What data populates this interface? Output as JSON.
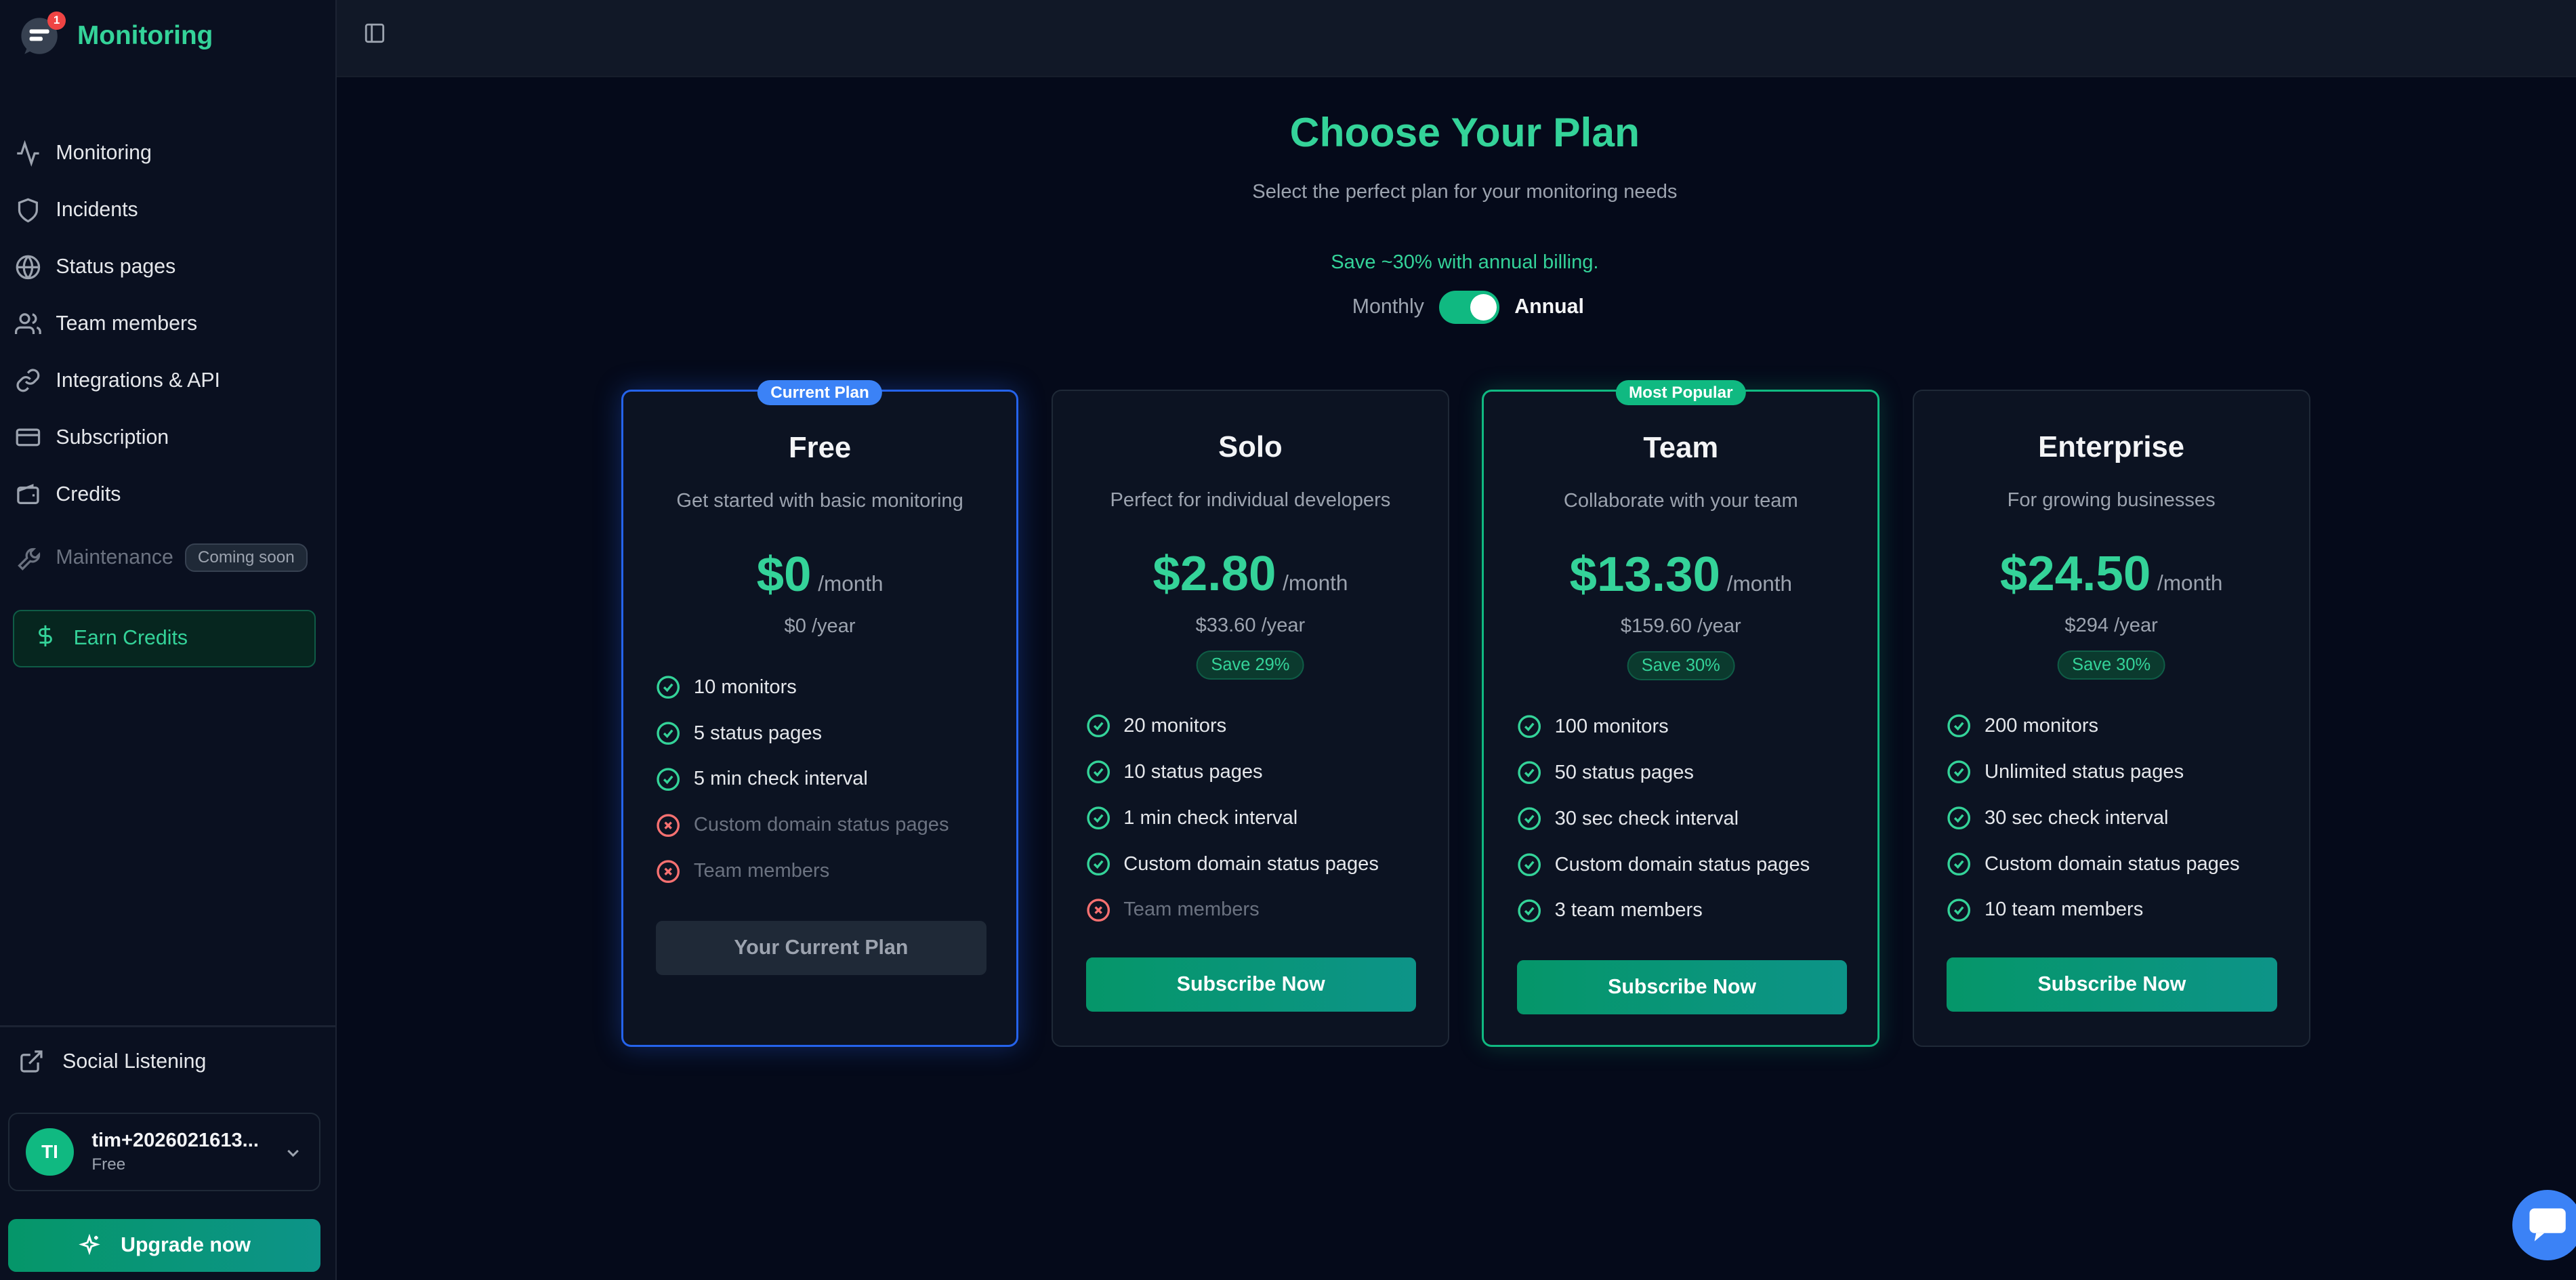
{
  "app": {
    "name": "Monitoring",
    "notification_count": "1"
  },
  "sidebar": {
    "items": [
      {
        "label": "Monitoring",
        "icon": "activity-icon"
      },
      {
        "label": "Incidents",
        "icon": "shield-icon"
      },
      {
        "label": "Status pages",
        "icon": "globe-icon"
      },
      {
        "label": "Team members",
        "icon": "users-icon"
      },
      {
        "label": "Integrations & API",
        "icon": "link-icon"
      },
      {
        "label": "Subscription",
        "icon": "credit-card-icon"
      },
      {
        "label": "Credits",
        "icon": "wallet-icon"
      }
    ],
    "maintenance": {
      "label": "Maintenance",
      "badge": "Coming soon"
    },
    "earn_credits": "Earn Credits",
    "social_listening": "Social Listening",
    "user": {
      "initials": "TI",
      "name": "tim+2026021613...",
      "plan": "Free"
    },
    "upgrade": "Upgrade now"
  },
  "page": {
    "title": "Choose Your Plan",
    "subtitle": "Select the perfect plan for your monitoring needs",
    "save_note": "Save ~30% with annual billing.",
    "billing": {
      "monthly": "Monthly",
      "annual": "Annual",
      "annual_selected": true
    }
  },
  "plans": [
    {
      "name": "Free",
      "tag": "Current Plan",
      "description": "Get started with basic monitoring",
      "price": "$0",
      "per": "/month",
      "yearly": "$0 /year",
      "save": "",
      "features": [
        {
          "text": "10 monitors",
          "included": true
        },
        {
          "text": "5 status pages",
          "included": true
        },
        {
          "text": "5 min check interval",
          "included": true
        },
        {
          "text": "Custom domain status pages",
          "included": false
        },
        {
          "text": "Team members",
          "included": false
        }
      ],
      "button": "Your Current Plan"
    },
    {
      "name": "Solo",
      "tag": "",
      "description": "Perfect for individual developers",
      "price": "$2.80",
      "per": "/month",
      "yearly": "$33.60 /year",
      "save": "Save 29%",
      "features": [
        {
          "text": "20 monitors",
          "included": true
        },
        {
          "text": "10 status pages",
          "included": true
        },
        {
          "text": "1 min check interval",
          "included": true
        },
        {
          "text": "Custom domain status pages",
          "included": true
        },
        {
          "text": "Team members",
          "included": false
        }
      ],
      "button": "Subscribe Now"
    },
    {
      "name": "Team",
      "tag": "Most Popular",
      "description": "Collaborate with your team",
      "price": "$13.30",
      "per": "/month",
      "yearly": "$159.60 /year",
      "save": "Save 30%",
      "features": [
        {
          "text": "100 monitors",
          "included": true
        },
        {
          "text": "50 status pages",
          "included": true
        },
        {
          "text": "30 sec check interval",
          "included": true
        },
        {
          "text": "Custom domain status pages",
          "included": true
        },
        {
          "text": "3 team members",
          "included": true
        }
      ],
      "button": "Subscribe Now"
    },
    {
      "name": "Enterprise",
      "tag": "",
      "description": "For growing businesses",
      "price": "$24.50",
      "per": "/month",
      "yearly": "$294 /year",
      "save": "Save 30%",
      "features": [
        {
          "text": "200 monitors",
          "included": true
        },
        {
          "text": "Unlimited status pages",
          "included": true
        },
        {
          "text": "30 sec check interval",
          "included": true
        },
        {
          "text": "Custom domain status pages",
          "included": true
        },
        {
          "text": "10 team members",
          "included": true
        }
      ],
      "button": "Subscribe Now"
    }
  ],
  "colors": {
    "accent": "#34d399",
    "current_border": "#2563eb",
    "popular_border": "#10b981",
    "background": "#050a1a"
  }
}
